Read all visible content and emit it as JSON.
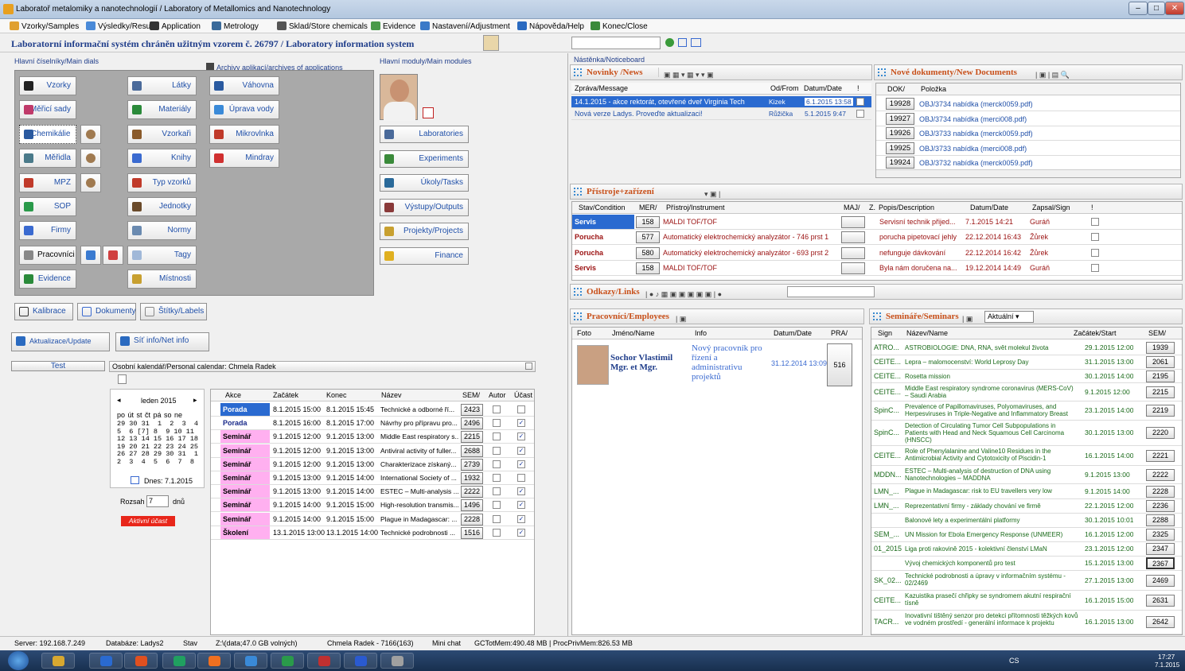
{
  "window": {
    "title": "Laboratoř metalomiky a nanotechnologií / Laboratory of Metallomics and Nanotechnology"
  },
  "menu": {
    "items": [
      "Vzorky/Samples",
      "Výsledky/Results",
      "Application",
      "Metrology",
      "Sklad/Store chemicals",
      "Evidence",
      "Nastavení/Adjustment",
      "Nápověda/Help",
      "Konec/Close"
    ]
  },
  "system": {
    "title": "Laboratorní informační systém chráněn užitným vzorem č. 26797 / Laboratory information system"
  },
  "main_dials": {
    "label": "Hlavní číselníky/Main dials",
    "col1": [
      "Vzorky",
      "Měřicí sady",
      "Chemikálie",
      "Měřidla",
      "MPZ",
      "SOP",
      "Firmy",
      "Pracovníci",
      "Evidence"
    ],
    "col2": [
      "Látky",
      "Materiály",
      "Vzorkaři",
      "Knihy",
      "Typ vzorků",
      "Jednotky",
      "Normy",
      "Tagy",
      "Místnosti"
    ]
  },
  "archives": {
    "label": "Archivy aplikací/archives of applications",
    "items": [
      "Váhovna",
      "Úprava vody",
      "Mikrovlnka",
      "Mindray"
    ]
  },
  "modules": {
    "label": "Hlavní moduly/Main modules",
    "items": [
      "Laboratories",
      "Experiments",
      "Úkoly/Tasks",
      "Výstupy/Outputs",
      "Projekty/Projects",
      "Finance"
    ]
  },
  "bottom_buttons": {
    "kalibrace": "Kalibrace",
    "dokumenty": "Dokumenty",
    "stitky": "Štítky/Labels",
    "update": "Aktualizace/Update",
    "netinfo": "Síť info/Net info",
    "test": "Test"
  },
  "calendar": {
    "title": "Osobní kalendář/Personal calendar: Chmela Radek",
    "month": "leden 2015",
    "weekdays": "po út st čt pá so ne",
    "weeks": [
      "29 30 31  1  2  3  4",
      "5  6 [7] 8  9 10 11",
      "12 13 14 15 16 17 18",
      "19 20 21 22 23 24 25",
      "26 27 28 29 30 31  1",
      "2  3  4  5  6  7  8"
    ],
    "today": "Dnes: 7.1.2015",
    "range_label": "Rozsah",
    "range_value": "7",
    "range_unit": "dnů",
    "active": "Aktivní účast",
    "headers": [
      "Akce",
      "Začátek",
      "Konec",
      "Název",
      "SEM/",
      "Autor",
      "Účast"
    ],
    "rows": [
      {
        "akce": "Porada",
        "start": "8.1.2015 15:00",
        "end": "8.1.2015 15:45",
        "name": "Technické a odborné ří...",
        "sem": "2423",
        "autor": "",
        "ucast": ""
      },
      {
        "akce": "Porada",
        "start": "8.1.2015 16:00",
        "end": "8.1.2015 17:00",
        "name": "Návrhy pro přípravu pro...",
        "sem": "2496",
        "autor": "",
        "ucast": "✓"
      },
      {
        "akce": "Seminář",
        "start": "9.1.2015 12:00",
        "end": "9.1.2015 13:00",
        "name": "Middle East respiratory s...",
        "sem": "2215",
        "autor": "",
        "ucast": "✓"
      },
      {
        "akce": "Seminář",
        "start": "9.1.2015 12:00",
        "end": "9.1.2015 13:00",
        "name": "Antiviral activity of fuller...",
        "sem": "2688",
        "autor": "",
        "ucast": "✓"
      },
      {
        "akce": "Seminář",
        "start": "9.1.2015 12:00",
        "end": "9.1.2015 13:00",
        "name": "Charakterizace získaný...",
        "sem": "2739",
        "autor": "",
        "ucast": "✓"
      },
      {
        "akce": "Seminář",
        "start": "9.1.2015 13:00",
        "end": "9.1.2015 14:00",
        "name": "International Society of ...",
        "sem": "1932",
        "autor": "",
        "ucast": ""
      },
      {
        "akce": "Seminář",
        "start": "9.1.2015 13:00",
        "end": "9.1.2015 14:00",
        "name": "ESTEC – Multi-analysis ...",
        "sem": "2222",
        "autor": "",
        "ucast": "✓"
      },
      {
        "akce": "Seminář",
        "start": "9.1.2015 14:00",
        "end": "9.1.2015 15:00",
        "name": "High-resolution transmis...",
        "sem": "1496",
        "autor": "",
        "ucast": "✓"
      },
      {
        "akce": "Seminář",
        "start": "9.1.2015 14:00",
        "end": "9.1.2015 15:00",
        "name": "Plague in Madagascar: ...",
        "sem": "2228",
        "autor": "",
        "ucast": "✓"
      },
      {
        "akce": "Školení",
        "start": "13.1.2015 13:00",
        "end": "13.1.2015 14:00",
        "name": "Technické podrobnosti ...",
        "sem": "1516",
        "autor": "",
        "ucast": "✓"
      }
    ]
  },
  "noticeboard": {
    "label": "Nástěnka/Noticeboard"
  },
  "news": {
    "title": "Novinky /News",
    "headers": [
      "Zpráva/Message",
      "Od/From",
      "Datum/Date",
      "!"
    ],
    "rows": [
      {
        "msg": "14.1.2015 - akce rektorát, otevřené dveř Virginia Tech",
        "from": "Kizek",
        "date": "6.1.2015 13:58"
      },
      {
        "msg": "Nová verze Ladys. Proveďte aktualizaci!",
        "from": "Růžička",
        "date": "5.1.2015 9:47"
      }
    ]
  },
  "documents": {
    "title": "Nové dokumenty/New Documents",
    "headers": [
      "DOK/",
      "Položka"
    ],
    "rows": [
      {
        "id": "19928",
        "item": "OBJ/3734 nabídka (merck0059.pdf)"
      },
      {
        "id": "19927",
        "item": "OBJ/3734 nabídka (merci008.pdf)"
      },
      {
        "id": "19926",
        "item": "OBJ/3733 nabídka (merck0059.pdf)"
      },
      {
        "id": "19925",
        "item": "OBJ/3733 nabídka (merci008.pdf)"
      },
      {
        "id": "19924",
        "item": "OBJ/3732 nabídka (merck0059.pdf)"
      }
    ]
  },
  "instruments": {
    "title": "Přístroje+zařízení",
    "headers": [
      "Stav/Condition",
      "MER/",
      "Přístroj/Instrument",
      "MAJ/",
      "Z.",
      "Popis/Description",
      "Datum/Date",
      "Zapsal/Sign",
      "!"
    ],
    "rows": [
      {
        "stav": "Servis",
        "mer": "158",
        "instr": "MALDI TOF/TOF",
        "desc": "Servisní technik přijed...",
        "date": "7.1.2015 14:21",
        "sign": "Guráň",
        "sel": true
      },
      {
        "stav": "Porucha",
        "mer": "577",
        "instr": "Automatický elektrochemický analyzátor - 746 prst 1",
        "desc": "porucha pipetovací jehly",
        "date": "22.12.2014 16:43",
        "sign": "Žůrek",
        "sel": false
      },
      {
        "stav": "Porucha",
        "mer": "580",
        "instr": "Automatický elektrochemický analyzátor - 693 prst 2",
        "desc": "nefunguje dávkování",
        "date": "22.12.2014 16:42",
        "sign": "Žůrek",
        "sel": false
      },
      {
        "stav": "Servis",
        "mer": "158",
        "instr": "MALDI TOF/TOF",
        "desc": "Byla nám doručena na...",
        "date": "19.12.2014 14:49",
        "sign": "Guráň",
        "sel": false
      }
    ]
  },
  "links": {
    "title": "Odkazy/Links"
  },
  "employees": {
    "title": "Pracovníci/Employees",
    "headers": [
      "Foto",
      "Jméno/Name",
      "Info",
      "Datum/Date",
      "PRA/"
    ],
    "row": {
      "name": "Sochor Vlastimil Mgr. et Mgr.",
      "info": "Nový pracovník pro řízení a administrativu projektů",
      "date": "31.12.2014 13:09",
      "pra": "516"
    }
  },
  "seminars": {
    "title": "Semináře/Seminars",
    "filter": "Aktuální",
    "headers": [
      "Sign",
      "Název/Name",
      "Začátek/Start",
      "SEM/"
    ],
    "rows": [
      {
        "sign": "ATRO...",
        "name": "ASTROBIOLOGIE: DNA, RNA, svět molekul života",
        "start": "29.1.2015 12:00",
        "sem": "1939"
      },
      {
        "sign": "CEITE...",
        "name": "Lepra – malomocenství: World Leprosy Day",
        "start": "31.1.2015 13:00",
        "sem": "2061"
      },
      {
        "sign": "CEITE...",
        "name": "Rosetta mission",
        "start": "30.1.2015 14:00",
        "sem": "2195"
      },
      {
        "sign": "CEITE...",
        "name": "Middle East respiratory syndrome coronavirus (MERS-CoV) – Saudi Arabia",
        "start": "9.1.2015 12:00",
        "sem": "2215"
      },
      {
        "sign": "SpinC...",
        "name": "Prevalence of Papillomaviruses, Polyomaviruses, and Herpesviruses in Triple-Negative and Inflammatory Breast",
        "start": "23.1.2015 14:00",
        "sem": "2219"
      },
      {
        "sign": "SpinC...",
        "name": "Detection of Circulating Tumor Cell Subpopulations in Patients with Head and Neck Squamous Cell Carcinoma (HNSCC)",
        "start": "30.1.2015 13:00",
        "sem": "2220"
      },
      {
        "sign": "CEITE...",
        "name": "Role of Phenylalanine and Valine10 Residues in the Antimicrobial Activity and Cytotoxicity of Piscidin-1",
        "start": "16.1.2015 14:00",
        "sem": "2221"
      },
      {
        "sign": "MDDN...",
        "name": "ESTEC – Multi-analysis of destruction of DNA using Nanotechnologies – MADDNA",
        "start": "9.1.2015 13:00",
        "sem": "2222"
      },
      {
        "sign": "LMN_...",
        "name": "Plague in Madagascar: risk to EU travellers very low",
        "start": "9.1.2015 14:00",
        "sem": "2228"
      },
      {
        "sign": "LMN_...",
        "name": "Reprezentativní firmy - základy chování ve firmě",
        "start": "22.1.2015 12:00",
        "sem": "2236"
      },
      {
        "sign": "",
        "name": "Balonové lety a experimentální platformy",
        "start": "30.1.2015 10:01",
        "sem": "2288"
      },
      {
        "sign": "SEM_...",
        "name": "UN Mission for Ebola Emergency Response (UNMEER)",
        "start": "16.1.2015 12:00",
        "sem": "2325"
      },
      {
        "sign": "01_2015",
        "name": "Liga proti rakovině 2015 - kolektivní členství LMaN",
        "start": "23.1.2015 12:00",
        "sem": "2347"
      },
      {
        "sign": "",
        "name": "Vývoj chemických komponentů pro test",
        "start": "15.1.2015 13:00",
        "sem": "2367"
      },
      {
        "sign": "SK_02...",
        "name": "Technické podrobnosti a úpravy v informačním systému - 02/2469",
        "start": "27.1.2015 13:00",
        "sem": "2469"
      },
      {
        "sign": "CEITE...",
        "name": "Kazuistika prasečí chřipky se syndromem akutní respirační tísně",
        "start": "16.1.2015 15:00",
        "sem": "2631"
      },
      {
        "sign": "TACR...",
        "name": "Inovativní tištěný senzor pro detekci přítomnosti těžkých kovů ve vodném prostředí - generální informace k projektu",
        "start": "16.1.2015 13:00",
        "sem": "2642"
      }
    ]
  },
  "status": {
    "server": "Server: 192.168.7.249",
    "db": "Databáze: Ladys2",
    "stav": "Stav",
    "disk": "Z:\\(data;47.0 GB volných)",
    "user": "Chmela Radek - 7166(163)",
    "chat": "Mini chat",
    "mem": "GCTotMem:490.48 MB | ProcPrivMem:826.53 MB"
  },
  "tray": {
    "lang": "CS",
    "time": "17:27",
    "date": "7.1.2015"
  }
}
